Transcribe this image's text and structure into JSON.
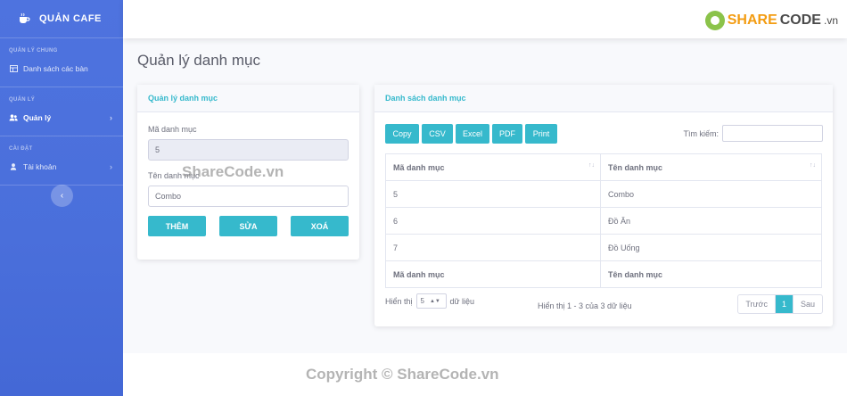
{
  "brand": {
    "title": "QUẢN CAFE",
    "icon": "coffee-cup-icon"
  },
  "sidebar": {
    "sections": [
      {
        "heading": "QUẢN LÝ CHUNG",
        "item": "Danh sách các bàn",
        "icon": "table-icon"
      },
      {
        "heading": "QUẢN LÝ",
        "item": "Quản lý",
        "icon": "users-icon"
      },
      {
        "heading": "CÀI ĐẶT",
        "item": "Tài khoản",
        "icon": "user-icon"
      }
    ],
    "toggle": "‹"
  },
  "topbar": {
    "logo_share": "SHARE",
    "logo_code": "CODE",
    "logo_vn": ".vn"
  },
  "page_title": "Quản lý danh mục",
  "form": {
    "title": "Quản lý danh mục",
    "id_label": "Mã danh mục",
    "id_value": "5",
    "name_label": "Tên danh mục",
    "name_value": "Combo",
    "add_label": "THÊM",
    "edit_label": "SỬA",
    "delete_label": "XOÁ"
  },
  "list": {
    "title": "Danh sách danh mục",
    "export_buttons": [
      "Copy",
      "CSV",
      "Excel",
      "PDF",
      "Print"
    ],
    "search_label": "Tìm kiếm:",
    "columns": [
      "Mã danh mục",
      "Tên danh mục"
    ],
    "rows": [
      [
        "5",
        "Combo"
      ],
      [
        "6",
        "Đồ Ăn"
      ],
      [
        "7",
        "Đồ Uống"
      ]
    ],
    "length_prefix": "Hiển thị",
    "length_value": "5",
    "length_suffix": "dữ liệu",
    "info": "Hiển thị 1 - 3 của 3 dữ liệu",
    "prev": "Trước",
    "page": "1",
    "next": "Sau"
  },
  "watermarks": {
    "center": "ShareCode.vn",
    "bottom": "Copyright © ShareCode.vn"
  },
  "colors": {
    "sidebar": "#4e73df",
    "accent": "#36b9cc"
  }
}
